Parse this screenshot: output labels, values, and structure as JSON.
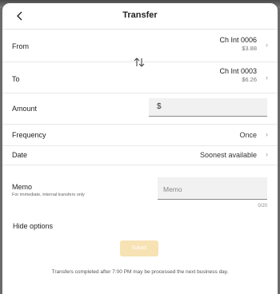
{
  "header": {
    "title": "Transfer",
    "back_icon": "chevron-left-icon"
  },
  "from": {
    "label": "From",
    "account_name": "Ch Int 0006",
    "balance": "$3.88"
  },
  "to": {
    "label": "To",
    "account_name": "Ch Int 0003",
    "balance": "$6.26"
  },
  "swap_icon": "swap-vertical-icon",
  "amount": {
    "label": "Amount",
    "prefix": "$",
    "value": ""
  },
  "frequency": {
    "label": "Frequency",
    "value": "Once"
  },
  "date": {
    "label": "Date",
    "value": "Soonest available"
  },
  "memo": {
    "label": "Memo",
    "sublabel": "For immediate, internal transfers only",
    "placeholder": "Memo",
    "counter": "0/20"
  },
  "hide_options_label": "Hide options",
  "submit_label": "Submit",
  "footnote": "Transfers completed after 7:00 PM may be processed the next business day.",
  "colors": {
    "submit_disabled": "#f7e2b4",
    "field_background": "#f1f1f1"
  }
}
